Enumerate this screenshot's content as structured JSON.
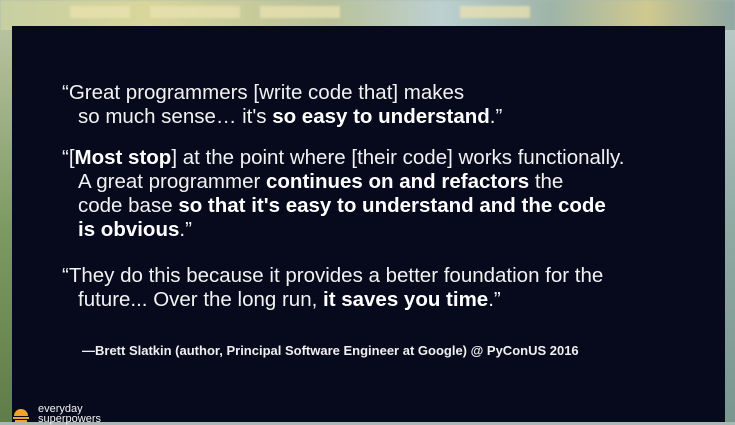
{
  "quotes": [
    {
      "line1": [
        {
          "t": "“Great programmers [write code that] makes"
        }
      ],
      "line2": [
        {
          "t": "so much sense… it's "
        },
        {
          "t": "so easy to understand",
          "b": true
        },
        {
          "t": ".”"
        }
      ]
    },
    {
      "line1": [
        {
          "t": "“["
        },
        {
          "t": "Most stop",
          "b": true
        },
        {
          "t": "] at the point where [their code] works functionally."
        }
      ],
      "line2": [
        {
          "t": "A great programmer "
        },
        {
          "t": "continues on and refactors",
          "b": true
        },
        {
          "t": " the"
        }
      ],
      "line3": [
        {
          "t": "code base "
        },
        {
          "t": "so that it's easy to understand and the code",
          "b": true
        }
      ],
      "line4": [
        {
          "t": "is obvious",
          "b": true
        },
        {
          "t": ".”"
        }
      ]
    },
    {
      "line1": [
        {
          "t": "“They do this because it provides a better foundation for the"
        }
      ],
      "line2": [
        {
          "t": "future... Over the long run, "
        },
        {
          "t": "it saves you time",
          "b": true
        },
        {
          "t": ".”"
        }
      ]
    }
  ],
  "attribution": "—Brett Slatkin (author, Principal Software Engineer at Google) @ PyConUS 2016",
  "logo": {
    "line1": "everyday",
    "line2": "superpowers",
    "icon": "sun-logo-icon",
    "color": "#f0a52a"
  }
}
